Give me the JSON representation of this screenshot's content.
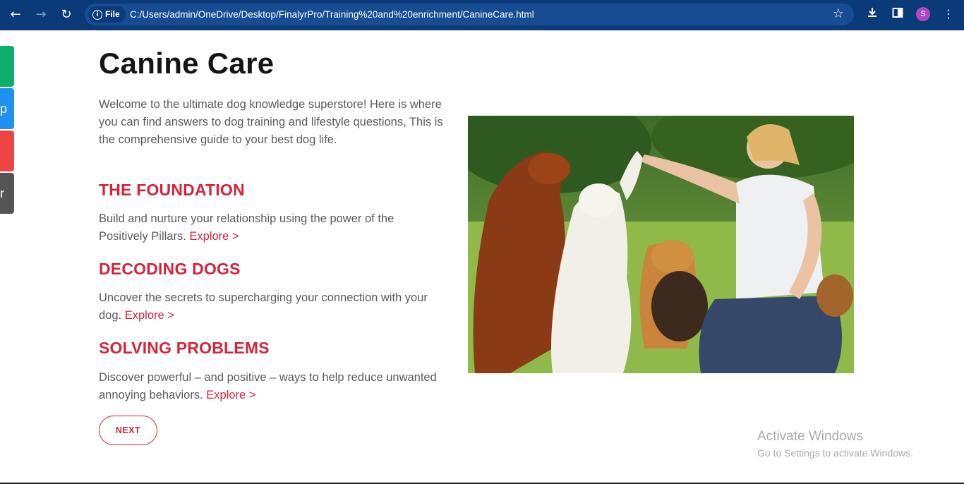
{
  "browser": {
    "url": "C:/Users/admin/OneDrive/Desktop/FinalyrPro/Training%20and%20enrichment/CanineCare.html",
    "site_info_label": "File",
    "back_icon": "back-arrow-icon",
    "forward_icon": "forward-arrow-icon",
    "reload_icon": "reload-icon",
    "profile_initial": "S",
    "colors": {
      "toolbar": "#0b3a79",
      "address_bar": "#174c93",
      "avatar": "#b146c2"
    }
  },
  "side_tabs": [
    {
      "glyph": "",
      "color": "#0fae6b"
    },
    {
      "glyph": "p",
      "color": "#1f8ff0"
    },
    {
      "glyph": "",
      "color": "#ef4444"
    },
    {
      "glyph": "r",
      "color": "#555555"
    }
  ],
  "page": {
    "title": "Canine Care",
    "intro": "Welcome to the ultimate dog knowledge superstore! Here is where you can find answers to dog training and lifestyle questions, This is the comprehensive guide to your best dog life.",
    "sections": [
      {
        "heading": "THE FOUNDATION",
        "text": "Build and nurture your relationship using the power of the Positively Pillars.",
        "link": "Explore >"
      },
      {
        "heading": "DECODING DOGS",
        "text": "Uncover the secrets to supercharging your connection with your dog.",
        "link": "Explore >"
      },
      {
        "heading": "SOLVING PROBLEMS",
        "text": "Discover powerful – and positive – ways to help reduce unwanted annoying behaviors.",
        "link": "Explore >"
      }
    ],
    "next_label": "NEXT",
    "accent_color": "#d1253c"
  },
  "watermark": {
    "title": "Activate Windows",
    "subtitle": "Go to Settings to activate Windows."
  }
}
